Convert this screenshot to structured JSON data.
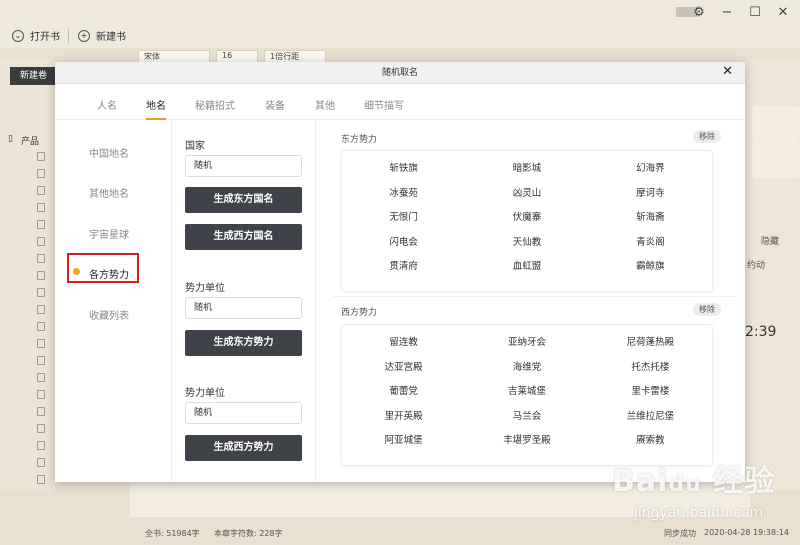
{
  "app": {
    "open_book": "打开书",
    "new_book": "新建书",
    "new_volume": "新建卷",
    "tree_root": "产品",
    "font_family": "宋体",
    "font_size": "16",
    "line_spacing": "1倍行距",
    "right_hide": "隐藏",
    "right_text": "约动",
    "right_time": "2:39",
    "status_words": "全书: 51984字",
    "status_chapter": "本章字符数: 228字",
    "sync": "同步成功",
    "timestamp": "2020-04-28 19:38:14"
  },
  "dialog": {
    "title": "随机取名",
    "close": "✕",
    "tabs": [
      "人名",
      "地名",
      "秘籍招式",
      "装备",
      "其他",
      "细节描写"
    ],
    "active_tab": "地名",
    "categories": [
      "中国地名",
      "其他地名",
      "宇宙星球",
      "各方势力",
      "收藏列表"
    ],
    "active_category": "各方势力",
    "groups": [
      {
        "label": "国家",
        "input": "随机",
        "buttons": [
          "生成东方国名",
          "生成西方国名"
        ]
      },
      {
        "label": "势力单位",
        "input": "随机",
        "buttons": [
          "生成东方势力"
        ]
      },
      {
        "label": "势力单位",
        "input": "随机",
        "buttons": [
          "生成西方势力"
        ]
      }
    ],
    "sections": [
      {
        "title": "东方势力",
        "remove": "移除",
        "names": [
          "斩铁旗",
          "暗影城",
          "幻海界",
          "冰蚕苑",
          "凶灵山",
          "摩诃寺",
          "无恨门",
          "伏魔寨",
          "斩海斋",
          "闪电会",
          "天仙教",
          "青炎阁",
          "贯清府",
          "血虹盟",
          "霸鲸旗"
        ]
      },
      {
        "title": "西方势力",
        "remove": "移除",
        "names": [
          "留连教",
          "亚纳牙会",
          "尼荷蓬热殿",
          "达亚宫殿",
          "海维党",
          "托杰托楼",
          "葡蕾党",
          "吉莱城堡",
          "里卡雷楼",
          "里开英殿",
          "马兰会",
          "兰维拉尼堡",
          "阿亚城堡",
          "丰堪罗圣殿",
          "赓索教"
        ]
      }
    ]
  },
  "watermark": {
    "brand": "Baidu经验",
    "url": "jingyan.baidu.com"
  }
}
